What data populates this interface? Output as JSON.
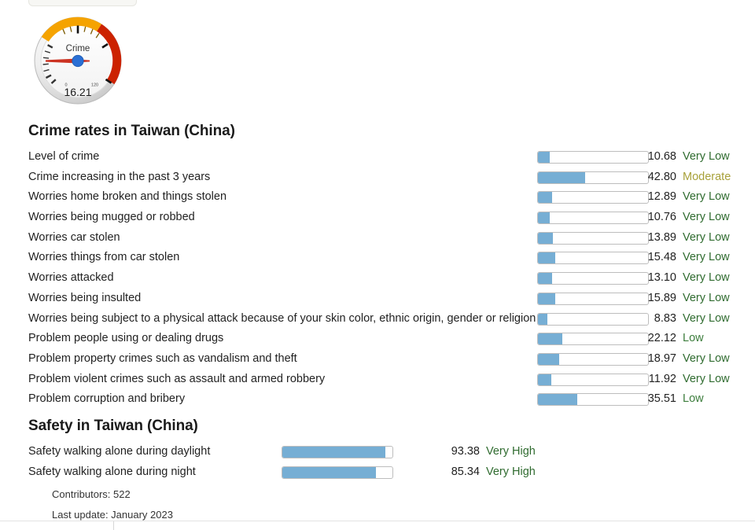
{
  "gauge": {
    "label": "Crime",
    "value": "16.21",
    "min_tick": "0",
    "max_tick": "120",
    "arc_orange": "#f5a300",
    "arc_red": "#cc2200",
    "needle_color": "#cc3322",
    "hub_color": "#2a6fd4"
  },
  "crime": {
    "title": "Crime rates in Taiwan (China)",
    "rows": [
      {
        "label": "Level of crime",
        "value": "10.68",
        "rating": "Very Low",
        "pct": 10.68
      },
      {
        "label": "Crime increasing in the past 3 years",
        "value": "42.80",
        "rating": "Moderate",
        "pct": 42.8
      },
      {
        "label": "Worries home broken and things stolen",
        "value": "12.89",
        "rating": "Very Low",
        "pct": 12.89
      },
      {
        "label": "Worries being mugged or robbed",
        "value": "10.76",
        "rating": "Very Low",
        "pct": 10.76
      },
      {
        "label": "Worries car stolen",
        "value": "13.89",
        "rating": "Very Low",
        "pct": 13.89
      },
      {
        "label": "Worries things from car stolen",
        "value": "15.48",
        "rating": "Very Low",
        "pct": 15.48
      },
      {
        "label": "Worries attacked",
        "value": "13.10",
        "rating": "Very Low",
        "pct": 13.1
      },
      {
        "label": "Worries being insulted",
        "value": "15.89",
        "rating": "Very Low",
        "pct": 15.89
      },
      {
        "label": "Worries being subject to a physical attack because of your skin color, ethnic origin, gender or religion",
        "value": "8.83",
        "rating": "Very Low",
        "pct": 8.83
      },
      {
        "label": "Problem people using or dealing drugs",
        "value": "22.12",
        "rating": "Low",
        "pct": 22.12
      },
      {
        "label": "Problem property crimes such as vandalism and theft",
        "value": "18.97",
        "rating": "Very Low",
        "pct": 18.97
      },
      {
        "label": "Problem violent crimes such as assault and armed robbery",
        "value": "11.92",
        "rating": "Very Low",
        "pct": 11.92
      },
      {
        "label": "Problem corruption and bribery",
        "value": "35.51",
        "rating": "Low",
        "pct": 35.51
      }
    ]
  },
  "safety": {
    "title": "Safety in Taiwan (China)",
    "rows": [
      {
        "label": "Safety walking alone during daylight",
        "value": "93.38",
        "rating": "Very High",
        "pct": 93.38
      },
      {
        "label": "Safety walking alone during night",
        "value": "85.34",
        "rating": "Very High",
        "pct": 85.34
      }
    ]
  },
  "meta": {
    "contributors": "Contributors: 522",
    "last_update": "Last update: January 2023"
  },
  "rating_colors": {
    "Very Low": "#2f6b2f",
    "Low": "#3c7d3c",
    "Moderate": "#a8a13a",
    "High": "#c06a20",
    "Very High": "#2f6b2f"
  },
  "bar_color": "#76aed4"
}
